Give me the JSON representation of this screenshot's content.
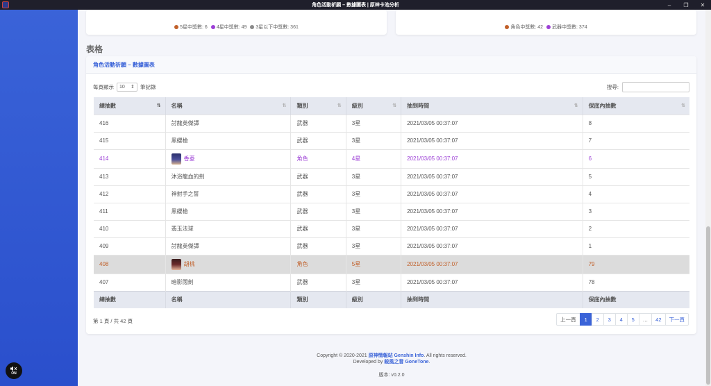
{
  "window": {
    "title": "角色活動祈願 – 數據圖表 | 原神卡池分析",
    "controls": [
      "–",
      "❐",
      "✕"
    ]
  },
  "summary": {
    "left_legend": [
      {
        "label": "5星中獎數: 6",
        "color": "#c1602a"
      },
      {
        "label": "4星中獎數: 49",
        "color": "#9c3fd6"
      },
      {
        "label": "3星以下中獎數: 361",
        "color": "#8a8a8a"
      }
    ],
    "right_legend": [
      {
        "label": "角色中獎數: 42",
        "color": "#c1602a"
      },
      {
        "label": "武器中獎數: 374",
        "color": "#9c3fd6"
      }
    ]
  },
  "section_title": "表格",
  "table_card": {
    "header": "角色活動祈願 – 數據圖表",
    "length_prefix": "每頁顯示",
    "length_value": "10",
    "length_suffix": "筆記錄",
    "search_label": "搜尋:",
    "search_value": "",
    "columns": [
      "總抽數",
      "名稱",
      "類別",
      "級別",
      "抽到時間",
      "保底內抽數"
    ],
    "rows": [
      {
        "total": "416",
        "name": "討龍英傑譚",
        "type": "武器",
        "rank": "3星",
        "time": "2021/03/05 00:37:07",
        "pity": "8"
      },
      {
        "total": "415",
        "name": "黑纓槍",
        "type": "武器",
        "rank": "3星",
        "time": "2021/03/05 00:37:07",
        "pity": "7"
      },
      {
        "total": "414",
        "name": "香菱",
        "type": "角色",
        "rank": "4星",
        "time": "2021/03/05 00:37:07",
        "pity": "6"
      },
      {
        "total": "413",
        "name": "沐浴龍血的劍",
        "type": "武器",
        "rank": "3星",
        "time": "2021/03/05 00:37:07",
        "pity": "5"
      },
      {
        "total": "412",
        "name": "神射手之誓",
        "type": "武器",
        "rank": "3星",
        "time": "2021/03/05 00:37:07",
        "pity": "4"
      },
      {
        "total": "411",
        "name": "黑纓槍",
        "type": "武器",
        "rank": "3星",
        "time": "2021/03/05 00:37:07",
        "pity": "3"
      },
      {
        "total": "410",
        "name": "翡玉法球",
        "type": "武器",
        "rank": "3星",
        "time": "2021/03/05 00:37:07",
        "pity": "2"
      },
      {
        "total": "409",
        "name": "討龍英傑譚",
        "type": "武器",
        "rank": "3星",
        "time": "2021/03/05 00:37:07",
        "pity": "1"
      },
      {
        "total": "408",
        "name": "胡桃",
        "type": "角色",
        "rank": "5星",
        "time": "2021/03/05 00:37:07",
        "pity": "79"
      },
      {
        "total": "407",
        "name": "暗影闊劍",
        "type": "武器",
        "rank": "3星",
        "time": "2021/03/05 00:37:07",
        "pity": "78"
      }
    ],
    "info": "第 1 頁 / 共 42 頁",
    "pagination": {
      "prev": "上一頁",
      "pages": [
        "1",
        "2",
        "3",
        "4",
        "5",
        "…",
        "42"
      ],
      "next": "下一頁"
    }
  },
  "footer": {
    "copyright_prefix": "Copyright © 2020-2021",
    "site_name": "原神情報站 Genshin Info",
    "copyright_suffix": ". All rights reserved.",
    "developed_prefix": "Developed by",
    "developer": "殺風之音 GoneTone",
    "version": "版本: v0.2.0"
  },
  "sound_toggle": "ON",
  "colors": {
    "accent": "#3a63d8",
    "five_star": "#c1602a",
    "four_star": "#9c3fd6"
  }
}
